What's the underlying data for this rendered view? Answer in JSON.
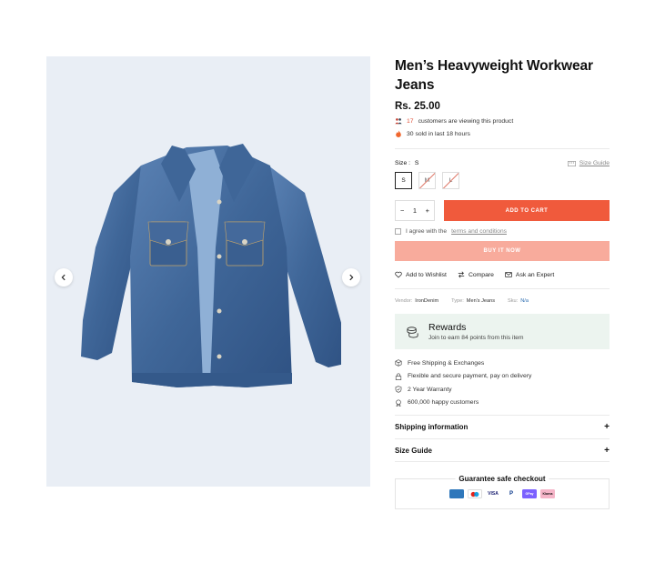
{
  "product": {
    "title_line1": "Men’s Heavyweight Workwear",
    "title_line2": "Jeans",
    "price": "Rs. 25.00"
  },
  "social_proof": {
    "viewers_count": "17",
    "viewers_text": "customers are viewing this product",
    "sold_text": "30 sold in last 18 hours"
  },
  "size": {
    "label": "Size :",
    "selected": "S",
    "guide_label": "Size Guide",
    "options": [
      "S",
      "M",
      "L"
    ]
  },
  "cart": {
    "qty_minus": "−",
    "qty_value": "1",
    "qty_plus": "+",
    "add_label": "ADD TO CART",
    "agree_prefix": "I agree with the",
    "terms_label": "terms and conditions",
    "buy_now_label": "BUY IT NOW"
  },
  "actions": {
    "wishlist": "Add to Wishlist",
    "compare": "Compare",
    "expert": "Ask an Expert"
  },
  "specs": {
    "vendor_label": "Vendor:",
    "vendor_value": "IronDenim",
    "type_label": "Type:",
    "type_value": "Men's Jeans",
    "sku_label": "Sku:",
    "sku_value": "N/a"
  },
  "rewards": {
    "title": "Rewards",
    "subtitle": "Join to earn 84 points from this item"
  },
  "perks": [
    "Free Shipping & Exchanges",
    "Flexible and secure payment, pay on delivery",
    "2 Year Warranty",
    "600,000 happy customers"
  ],
  "accordion": {
    "shipping": "Shipping information",
    "size_guide": "Size Guide",
    "expand_symbol": "+"
  },
  "guarantee": {
    "title": "Guarantee safe checkout",
    "payment_icons": [
      "amex",
      "maestro",
      "visa",
      "paypal",
      "gpay",
      "klarna"
    ]
  },
  "colors": {
    "accent": "#f05a3c",
    "accent_light": "#f8ab9c",
    "rewards_bg": "#ecf4ef",
    "gallery_bg": "#e9eef5"
  }
}
